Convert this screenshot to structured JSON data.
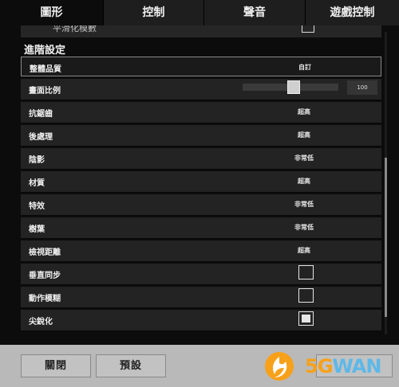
{
  "tabs": [
    {
      "label": "圖形",
      "active": true
    },
    {
      "label": "控制",
      "active": false
    },
    {
      "label": "聲音",
      "active": false
    },
    {
      "label": "遊戲控制",
      "active": false
    }
  ],
  "partial_row": {
    "label": "平滑化模數",
    "checked": false
  },
  "section_title": "進階設定",
  "settings": [
    {
      "label": "整體品質",
      "value": "自訂"
    },
    {
      "label": "畫面比例",
      "value": "100",
      "slider_fraction": 0.53
    },
    {
      "label": "抗鋸齒",
      "value": "超高"
    },
    {
      "label": "後處理",
      "value": "超高"
    },
    {
      "label": "陰影",
      "value": "非常低"
    },
    {
      "label": "材質",
      "value": "超高"
    },
    {
      "label": "特效",
      "value": "非常低"
    },
    {
      "label": "樹葉",
      "value": "非常低"
    },
    {
      "label": "檢視距離",
      "value": "超高"
    },
    {
      "label": "垂直同步",
      "checked": false
    },
    {
      "label": "動作模糊",
      "checked": false
    },
    {
      "label": "尖銳化",
      "checked": true
    }
  ],
  "buttons": {
    "close": "關閉",
    "preset": "預設"
  },
  "watermark": {
    "text_g": "5G",
    "text_rest": "WAN"
  },
  "colors": {
    "background": "#0c0c0c",
    "row": "#232323",
    "footer": "#b9b9b9"
  }
}
